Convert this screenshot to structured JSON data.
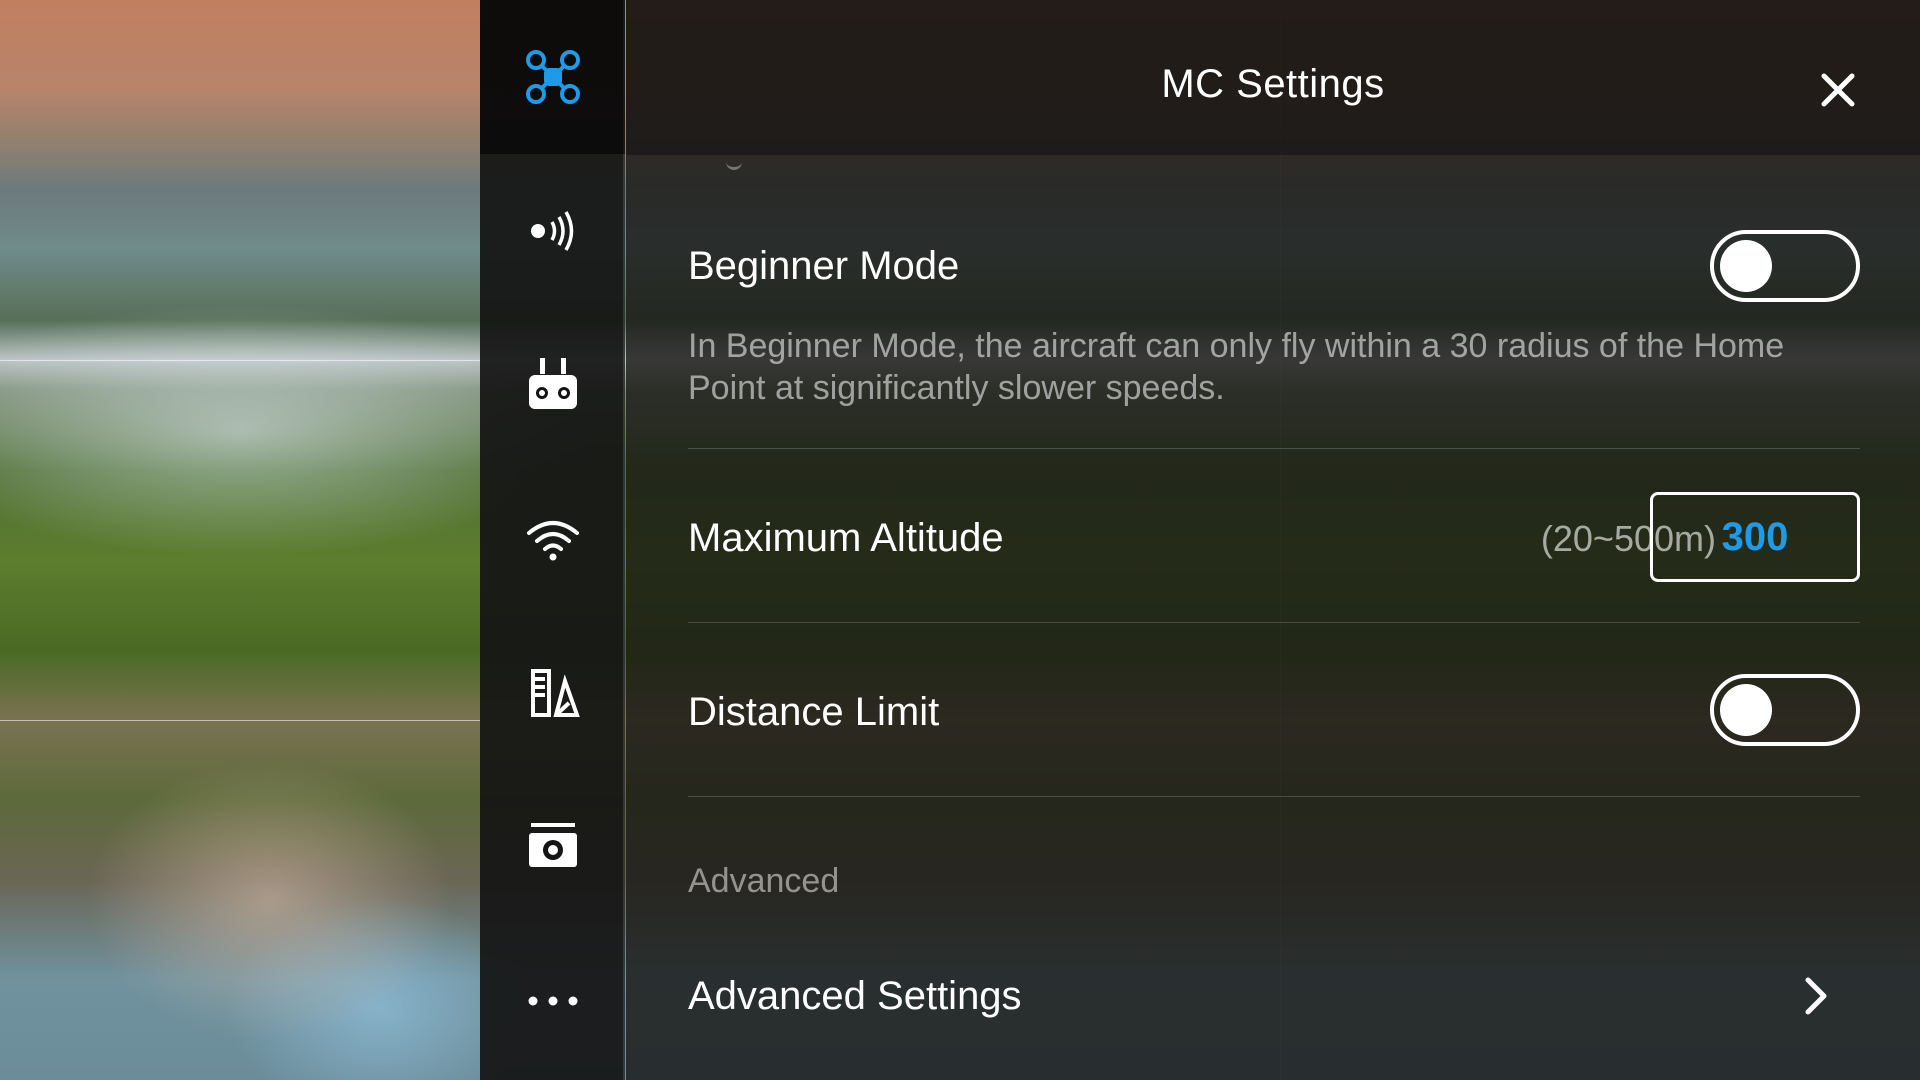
{
  "camera": {
    "description_icon": "landscape-feed"
  },
  "rail": {
    "items": [
      {
        "name": "aircraft-icon",
        "active": true
      },
      {
        "name": "sensors-icon",
        "active": false
      },
      {
        "name": "remote-controller-icon",
        "active": false
      },
      {
        "name": "wifi-icon",
        "active": false
      },
      {
        "name": "battery-icon",
        "active": false
      },
      {
        "name": "camera-icon",
        "active": false
      },
      {
        "name": "more-icon",
        "active": false
      }
    ]
  },
  "header": {
    "title": "MC Settings",
    "close_icon": "close-icon"
  },
  "settings": {
    "beginner_mode": {
      "label": "Beginner Mode",
      "enabled": false,
      "description": "In Beginner Mode, the aircraft can only fly within a 30 radius of the Home Point at significantly slower speeds."
    },
    "max_altitude": {
      "label": "Maximum Altitude",
      "range": "(20~500m)",
      "value": "300"
    },
    "distance_limit": {
      "label": "Distance Limit",
      "enabled": false
    },
    "advanced_section": {
      "header": "Advanced"
    },
    "advanced_settings": {
      "label": "Advanced Settings",
      "icon": "chevron-right-icon"
    }
  },
  "colors": {
    "accent": "#1e9be8",
    "text": "#ffffff",
    "muted": "#8c8c8c"
  }
}
